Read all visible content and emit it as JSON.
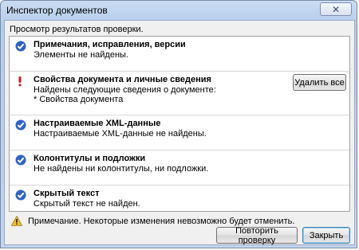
{
  "window": {
    "title": "Инспектор документов",
    "close_label": "✕"
  },
  "subtitle": "Просмотр результатов проверки.",
  "sections": [
    {
      "heading": "Примечания, исправления, версии",
      "text": "Элементы не найдены.",
      "status": "ok"
    },
    {
      "heading": "Свойства документа и личные сведения",
      "text": "Найдены следующие сведения о документе:",
      "text2": "* Свойства документа",
      "status": "found",
      "action_label": "Удалить все"
    },
    {
      "heading": "Настраиваемые XML-данные",
      "text": "Настраиваемые XML-данные не найдены.",
      "status": "ok"
    },
    {
      "heading": "Колонтитулы и подложки",
      "text": "Не найдены ни колонтитулы, ни подложки.",
      "status": "ok"
    },
    {
      "heading": "Скрытый текст",
      "text": "Скрытый текст не найден.",
      "status": "ok"
    }
  ],
  "note": "Примечание. Некоторые изменения невозможно будет отменить.",
  "buttons": {
    "recheck": "Повторить проверку",
    "close": "Закрыть"
  },
  "colors": {
    "ok_icon": "#2f62c4",
    "found_icon": "#d11a1a",
    "warning_icon": "#f2c230"
  }
}
